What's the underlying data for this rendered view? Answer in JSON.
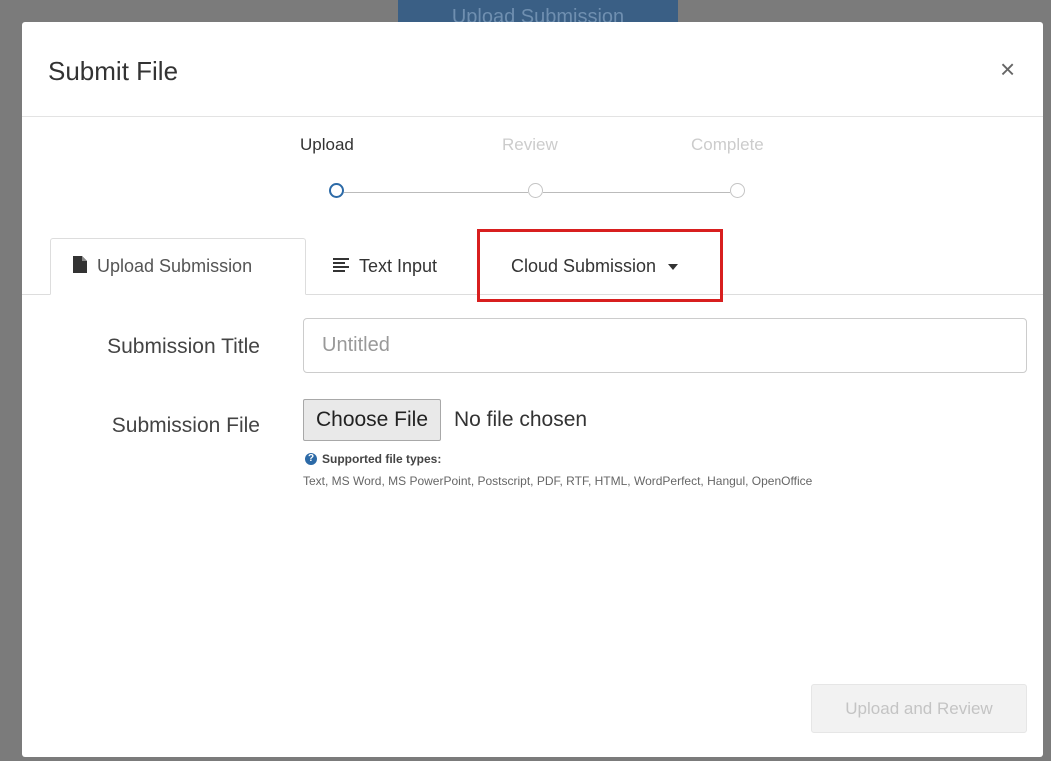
{
  "background": {
    "button_label": "Upload Submission"
  },
  "modal": {
    "title": "Submit File",
    "close_icon": "close-icon",
    "close_glyph": "×"
  },
  "steps": [
    {
      "label": "Upload",
      "state": "active"
    },
    {
      "label": "Review",
      "state": "inactive"
    },
    {
      "label": "Complete",
      "state": "inactive"
    }
  ],
  "tabs": [
    {
      "label": "Upload Submission",
      "icon": "file-icon",
      "active": true
    },
    {
      "label": "Text Input",
      "icon": "text-lines-icon",
      "active": false
    },
    {
      "label": "Cloud Submission",
      "icon": "caret-down-icon",
      "active": false,
      "dropdown": true
    }
  ],
  "form": {
    "title_label": "Submission Title",
    "title_placeholder": "Untitled",
    "file_label": "Submission File",
    "choose_file_label": "Choose File",
    "no_file_text": "No file chosen",
    "supported_heading": "Supported file types:",
    "supported_types": "Text, MS Word, MS PowerPoint, Postscript, PDF, RTF, HTML, WordPerfect, Hangul, OpenOffice",
    "help_icon": "question-circle-icon"
  },
  "footer": {
    "upload_button_label": "Upload and Review",
    "upload_button_disabled": true
  },
  "colors": {
    "accent": "#2c6aa7",
    "highlight": "#d81f1f",
    "overlay": "#7b7b7b"
  }
}
